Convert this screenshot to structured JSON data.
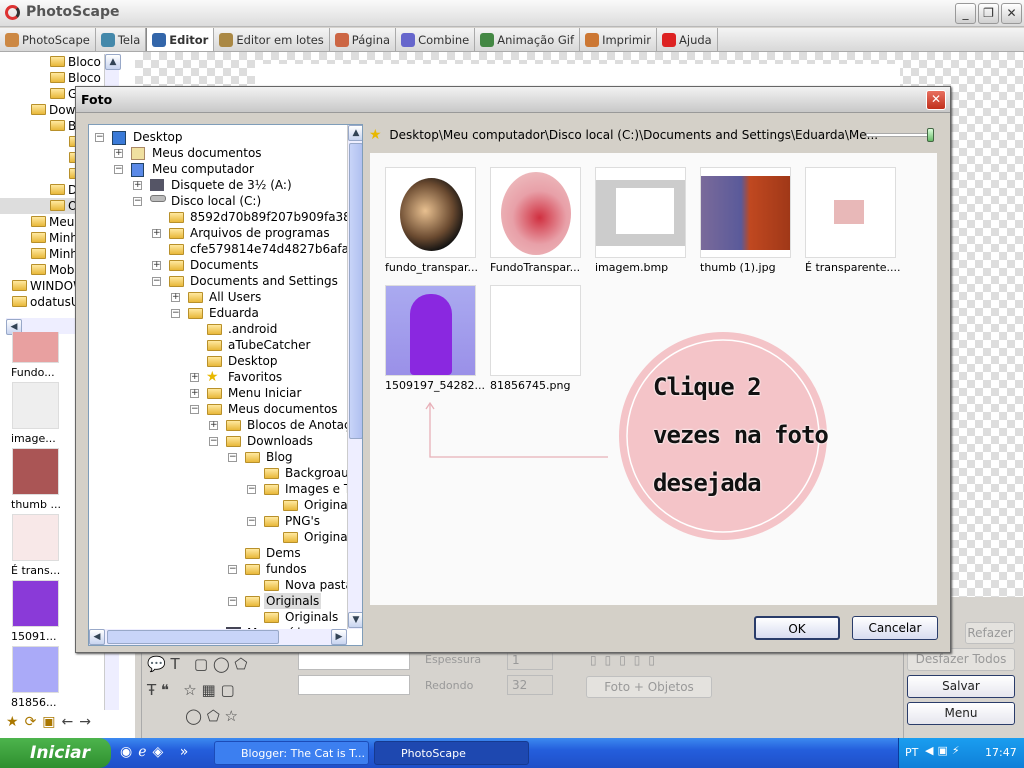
{
  "app": {
    "title": "PhotoScape"
  },
  "tabs": [
    {
      "label": "PhotoScape",
      "color": "#c84"
    },
    {
      "label": "Tela",
      "color": "#48a"
    },
    {
      "label": "Editor",
      "color": "#36a",
      "active": true
    },
    {
      "label": "Editor em lotes",
      "color": "#a84"
    },
    {
      "label": "Página",
      "color": "#c64"
    },
    {
      "label": "Combine",
      "color": "#66c"
    },
    {
      "label": "Animação Gif",
      "color": "#484"
    },
    {
      "label": "Imprimir",
      "color": "#c73"
    },
    {
      "label": "Ajuda",
      "color": "#d22"
    }
  ],
  "left_tree": [
    {
      "label": "Bloco de",
      "level": 2
    },
    {
      "label": "Bloco de",
      "level": 2
    },
    {
      "label": "Guia",
      "level": 2
    },
    {
      "label": "Downlo",
      "level": 1
    },
    {
      "label": "Blog",
      "level": 2
    },
    {
      "label": "B",
      "level": 3
    },
    {
      "label": "I",
      "level": 3
    },
    {
      "label": "P",
      "level": 3
    },
    {
      "label": "Dem",
      "level": 2
    },
    {
      "label": "Orig",
      "level": 2,
      "selected": true
    },
    {
      "label": "Meus vi",
      "level": 1
    },
    {
      "label": "Minhas",
      "level": 1
    },
    {
      "label": "Minhas",
      "level": 1
    },
    {
      "label": "Mobogе",
      "level": 1
    },
    {
      "label": "WINDOWS",
      "level": 0
    },
    {
      "label": "odatusUser",
      "level": 0
    }
  ],
  "left_thumbs": [
    {
      "label": "Fundo...",
      "color": "#e8a0a0"
    },
    {
      "label": "image...",
      "color": "#eee"
    },
    {
      "label": "thumb ...",
      "color": "#a55"
    },
    {
      "label": "É trans...",
      "color": "#f8e8e8"
    },
    {
      "label": "15091...",
      "color": "#8a3ad8"
    },
    {
      "label": "81856...",
      "color": "#aaaaf8"
    }
  ],
  "dialog": {
    "title": "Foto",
    "path": "Desktop\\Meu computador\\Disco local (C:)\\Documents and Settings\\Eduarda\\Me...",
    "zoom_slider": 1.0,
    "ok": "OK",
    "cancel": "Cancelar",
    "tree": [
      {
        "label": "Desktop",
        "level": 0,
        "exp": "-",
        "icon": "desktop"
      },
      {
        "label": "Meus documentos",
        "level": 1,
        "exp": "+",
        "icon": "docs"
      },
      {
        "label": "Meu computador",
        "level": 1,
        "exp": "-",
        "icon": "computer"
      },
      {
        "label": "Disquete de 3½ (A:)",
        "level": 2,
        "exp": "+",
        "icon": "floppy"
      },
      {
        "label": "Disco local (C:)",
        "level": 2,
        "exp": "-",
        "icon": "drive"
      },
      {
        "label": "8592d70b89f207b909fa38b0",
        "level": 3
      },
      {
        "label": "Arquivos de programas",
        "level": 3,
        "exp": "+"
      },
      {
        "label": "cfe579814e74d4827b6afa19",
        "level": 3
      },
      {
        "label": "Documents",
        "level": 3,
        "exp": "+"
      },
      {
        "label": "Documents and Settings",
        "level": 3,
        "exp": "-"
      },
      {
        "label": "All Users",
        "level": 4,
        "exp": "+"
      },
      {
        "label": "Eduarda",
        "level": 4,
        "exp": "-"
      },
      {
        "label": ".android",
        "level": 5
      },
      {
        "label": "aTubeCatcher",
        "level": 5
      },
      {
        "label": "Desktop",
        "level": 5
      },
      {
        "label": "Favoritos",
        "level": 5,
        "exp": "+",
        "icon": "star"
      },
      {
        "label": "Menu Iniciar",
        "level": 5,
        "exp": "+"
      },
      {
        "label": "Meus documentos",
        "level": 5,
        "exp": "-"
      },
      {
        "label": "Blocos de Anotações",
        "level": 6,
        "exp": "+"
      },
      {
        "label": "Downloads",
        "level": 6,
        "exp": "-"
      },
      {
        "label": "Blog",
        "level": 7,
        "exp": "-"
      },
      {
        "label": "Backgroaund",
        "level": 8
      },
      {
        "label": "Images e Textos",
        "level": 8,
        "exp": "-"
      },
      {
        "label": "Originals",
        "level": 9
      },
      {
        "label": "PNG's",
        "level": 8,
        "exp": "-"
      },
      {
        "label": "Originals",
        "level": 9
      },
      {
        "label": "Dems",
        "level": 7
      },
      {
        "label": "fundos",
        "level": 7,
        "exp": "-"
      },
      {
        "label": "Nova pasta",
        "level": 8
      },
      {
        "label": "Originals",
        "level": 7,
        "exp": "-",
        "selected": true
      },
      {
        "label": "Originals",
        "level": 8
      },
      {
        "label": "Meus vídeos",
        "level": 6,
        "icon": "video"
      }
    ],
    "files": [
      {
        "name": "fundo_transpar...",
        "kind": "circle-dark"
      },
      {
        "name": "FundoTranspar...",
        "kind": "circle-pink"
      },
      {
        "name": "imagem.bmp",
        "kind": "screenshot"
      },
      {
        "name": "thumb (1).jpg",
        "kind": "photo"
      },
      {
        "name": "É transparente....",
        "kind": "small"
      },
      {
        "name": "1509197_54282...",
        "kind": "purple"
      },
      {
        "name": "81856745.png",
        "kind": "blank"
      }
    ],
    "annotation": {
      "lines": [
        "Clique 2",
        "vezes na foto",
        "desejada"
      ],
      "circle_color": "#f4c4c8",
      "arrow_color": "#e8b0b8"
    }
  },
  "toolbar": {
    "espessura_label": "Espessura",
    "espessura_value": "1",
    "redondo_label": "Redondo",
    "redondo_value": "32",
    "foto_objetos": "Foto + Objetos",
    "refazer": "Refazer",
    "desfazer_todos": "Desfazer Todos",
    "salvar": "Salvar",
    "menu": "Menu"
  },
  "taskbar": {
    "start": "Iniciar",
    "tasks": [
      "Blogger: The Cat is T...",
      "PhotoScape"
    ],
    "lang": "PT",
    "time": "17:47"
  }
}
